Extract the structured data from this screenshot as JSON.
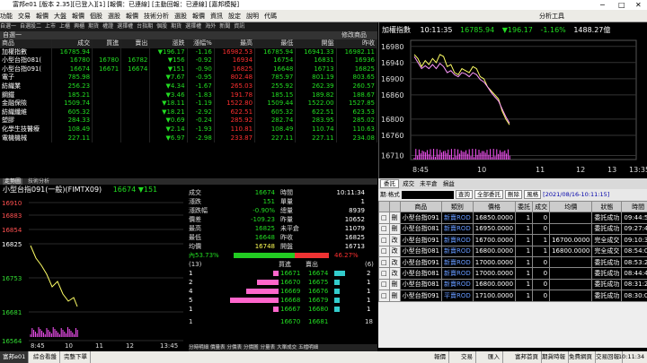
{
  "titlebar": {
    "text": "富邦e01 [版本 2.35][已登入][1] [報價：已連線] [主動回報：已連線] [嘉邦模擬]"
  },
  "menu": [
    "功能",
    "交易",
    "報價",
    "大盤",
    "報價",
    "個股",
    "選股",
    "報價",
    "技術分析",
    "選股",
    "報價",
    "資訊",
    "設定",
    "說明",
    "代碼"
  ],
  "menu_right": "分析工具",
  "tabs_top": [
    "自選一",
    "自選股二",
    "上市",
    "上櫃",
    "興櫃",
    "期貨",
    "權證",
    "選擇權",
    "台指期",
    "個股",
    "期貨",
    "選擇權",
    "海外",
    "新聞",
    "資訊"
  ],
  "watch_header": {
    "title": "自選一",
    "right": "修改商品",
    "columns": [
      "商品",
      "成交",
      "買進",
      "賣出",
      "漲跌",
      "漲幅%",
      "最高",
      "最低",
      "開盤",
      "昨收"
    ]
  },
  "watch_rows": [
    {
      "name": "加權指數",
      "last": "16785.94",
      "bid": "",
      "ask": "",
      "chg": "196.17",
      "pct": "-1.16",
      "high": "16982.53",
      "low": "16785.94",
      "open": "16941.33",
      "prev": "16982.11",
      "c": "dn"
    },
    {
      "name": "小型台指081(",
      "last": "16780",
      "bid": "16780",
      "ask": "16782",
      "chg": "156",
      "pct": "-0.92",
      "high": "16934",
      "low": "16754",
      "open": "16831",
      "prev": "16936",
      "c": "dn"
    },
    {
      "name": "小型台指091(",
      "last": "16674",
      "bid": "16671",
      "ask": "16674",
      "chg": "151",
      "pct": "-0.90",
      "high": "16825",
      "low": "16648",
      "open": "16713",
      "prev": "16825",
      "c": "dn"
    },
    {
      "name": "電子",
      "last": "785.98",
      "bid": "",
      "ask": "",
      "chg": "7.67",
      "pct": "-0.95",
      "high": "802.48",
      "low": "785.97",
      "open": "801.19",
      "prev": "803.65",
      "c": "dn"
    },
    {
      "name": "紡織業",
      "last": "256.23",
      "bid": "",
      "ask": "",
      "chg": "4.34",
      "pct": "-1.67",
      "high": "265.03",
      "low": "255.92",
      "open": "262.39",
      "prev": "260.57",
      "c": "dn"
    },
    {
      "name": "鋼鐵",
      "last": "185.21",
      "bid": "",
      "ask": "",
      "chg": "3.46",
      "pct": "-1.83",
      "high": "191.78",
      "low": "185.15",
      "open": "189.82",
      "prev": "188.67",
      "c": "dn"
    },
    {
      "name": "金融保險",
      "last": "1509.74",
      "bid": "",
      "ask": "",
      "chg": "18.11",
      "pct": "-1.19",
      "high": "1522.80",
      "low": "1509.44",
      "open": "1522.00",
      "prev": "1527.85",
      "c": "dn"
    },
    {
      "name": "紡織纖維",
      "last": "605.32",
      "bid": "",
      "ask": "",
      "chg": "18.21",
      "pct": "-2.92",
      "high": "622.51",
      "low": "605.32",
      "open": "622.51",
      "prev": "623.53",
      "c": "dn"
    },
    {
      "name": "塑膠",
      "last": "284.33",
      "bid": "",
      "ask": "",
      "chg": "0.69",
      "pct": "-0.24",
      "high": "285.92",
      "low": "282.74",
      "open": "283.95",
      "prev": "285.02",
      "c": "dn"
    },
    {
      "name": "化學生技醫療",
      "last": "108.49",
      "bid": "",
      "ask": "",
      "chg": "2.14",
      "pct": "-1.93",
      "high": "110.81",
      "low": "108.49",
      "open": "110.74",
      "prev": "110.63",
      "c": "dn"
    },
    {
      "name": "電機機械",
      "last": "227.11",
      "bid": "",
      "ask": "",
      "chg": "6.97",
      "pct": "-2.98",
      "high": "233.87",
      "open": "227.11",
      "low": "227.11",
      "prev": "234.08",
      "c": "dn"
    }
  ],
  "index_chart": {
    "title": "加權指數",
    "time": "10:11:35",
    "last": "16785.94",
    "chg": "196.17",
    "pct": "-1.16%",
    "vol": "1488.27億",
    "chart_data": {
      "type": "line",
      "y_ticks": [
        16980,
        16940,
        16900,
        16860,
        16800,
        16760,
        16710
      ],
      "x_ticks": [
        "8:45",
        "10",
        "11",
        "12",
        "13",
        "13:35"
      ],
      "series": [
        {
          "values": [
            16960,
            16950,
            16930,
            16945,
            16935,
            16950,
            16940,
            16960,
            16955,
            16930,
            16935,
            16915,
            16910,
            16925,
            16920,
            16915,
            16930,
            16925,
            16905,
            16900,
            16880,
            16870,
            16860,
            16850,
            16820,
            16800,
            16786
          ]
        },
        {
          "values": [
            16955,
            16940,
            16925,
            16932,
            16925,
            16935,
            16925,
            16938,
            16930,
            16915,
            16920,
            16910,
            16905,
            16915,
            16912,
            16905,
            16915,
            16910,
            16898,
            16892,
            16880,
            16866,
            16855,
            16845,
            16825,
            16806,
            16790
          ]
        }
      ]
    }
  },
  "quote": {
    "tabs": [
      "走勢圖",
      "技術分析"
    ],
    "name": "小型台指091(一般)(FIMTX09)",
    "last": "16674",
    "chg": "151",
    "fields": [
      {
        "k": "成交",
        "v": "16674",
        "k2": "時間",
        "v2": "10:11:34"
      },
      {
        "k": "漲跌",
        "v": "151",
        "k2": "單量",
        "v2": "1"
      },
      {
        "k": "漲跌幅",
        "v": "-0.90%",
        "k2": "總量",
        "v2": "8939"
      },
      {
        "k": "價差",
        "v": "-109.23",
        "k2": "昨量",
        "v2": "10652"
      },
      {
        "k": "最高",
        "v": "16825",
        "k2": "未平倉",
        "v2": "11079"
      },
      {
        "k": "最低",
        "v": "16648",
        "k2": "昨收",
        "v2": "16825"
      },
      {
        "k": "均價",
        "v": "16748",
        "k2": "開盤",
        "v2": "16713"
      }
    ],
    "ratio_left": "內53.73%",
    "ratio_right": "46.27%",
    "book_head": {
      "left": "(13)",
      "mid1": "買進",
      "mid2": "賣出",
      "right": "(6)"
    },
    "book": [
      {
        "bq": "1",
        "bp": "16671",
        "ap": "16674",
        "aq": "2",
        "bw": 0.1,
        "aw": 0.4
      },
      {
        "bq": "2",
        "bp": "16670",
        "ap": "16675",
        "aq": "1",
        "bw": 0.4,
        "aw": 0.2
      },
      {
        "bq": "4",
        "bp": "16669",
        "ap": "16676",
        "aq": "1",
        "bw": 0.6,
        "aw": 0.2
      },
      {
        "bq": "5",
        "bp": "16668",
        "ap": "16679",
        "aq": "1",
        "bw": 0.9,
        "aw": 0.2
      },
      {
        "bq": "1",
        "bp": "16667",
        "ap": "16680",
        "aq": "1",
        "bw": 0.1,
        "aw": 0.2
      }
    ],
    "book_foot": {
      "left": "1",
      "bid": "16670",
      "ask": "16681",
      "right": "18"
    },
    "tabs_bottom": [
      "分時明細",
      "價量表",
      "分價表",
      "分價圖",
      "分量表",
      "大單成交",
      "五檔明細"
    ]
  },
  "mini_chart": {
    "chart_data": {
      "type": "line",
      "y_ticks": [
        16910,
        16883,
        16854,
        16825,
        16753,
        16681,
        16564
      ],
      "x_ticks": [
        "8:45",
        "10",
        "11",
        "12",
        "13:45"
      ]
    },
    "label": "16825"
  },
  "orders": {
    "account_label": "期:格式",
    "query": "查詢",
    "filter": "全部委託",
    "delete": "刪除",
    "scroll": "風格",
    "date": "[2021/08/16-10:11:15]",
    "columns": [
      "",
      "",
      "商品",
      "類別",
      "價格",
      "委託",
      "成交",
      "均價",
      "狀態",
      "時間"
    ],
    "rows": [
      {
        "x": "刪",
        "product": "小型台指091",
        "type": "新賣ROD",
        "price": "16850.0000",
        "q": "1",
        "f": "0",
        "avg": "",
        "status": "委託成功",
        "time": "09:44:54"
      },
      {
        "x": "刪",
        "product": "小型台指081",
        "type": "新賣ROD",
        "price": "16950.0000",
        "q": "1",
        "f": "0",
        "avg": "",
        "status": "委託成功",
        "time": "09:27:43"
      },
      {
        "x": "改",
        "product": "小型台指091",
        "type": "新賣ROD",
        "price": "16700.0000",
        "q": "1",
        "f": "1",
        "avg": "16700.0000",
        "status": "完全成交",
        "time": "09:10:39"
      },
      {
        "x": "改",
        "product": "小型台指081",
        "type": "新賣ROD",
        "price": "16800.0000",
        "q": "1",
        "f": "1",
        "avg": "16800.0000",
        "status": "完全成交",
        "time": "08:54:03"
      },
      {
        "x": "改",
        "product": "小型台指091",
        "type": "新賣ROD",
        "price": "17000.0000",
        "q": "1",
        "f": "0",
        "avg": "",
        "status": "委託成功",
        "time": "08:53:22"
      },
      {
        "x": "改",
        "product": "小型台指081",
        "type": "新賣ROD",
        "price": "17000.0000",
        "q": "1",
        "f": "0",
        "avg": "",
        "status": "委託成功",
        "time": "08:44:44"
      },
      {
        "x": "刪",
        "product": "小型台指081",
        "type": "新賣ROD",
        "price": "16800.0000",
        "q": "1",
        "f": "0",
        "avg": "",
        "status": "委託成功",
        "time": "08:31:23"
      },
      {
        "x": "刪",
        "product": "小型台指091",
        "type": "平賣ROD",
        "price": "17100.0000",
        "q": "1",
        "f": "0",
        "avg": "",
        "status": "委託成功",
        "time": "08:30:03"
      }
    ]
  },
  "statusbar": {
    "left_tabs": [
      "富邦e01",
      "綜合看盤",
      "完整下單"
    ],
    "right_items": [
      "報價",
      "交易",
      "匯入",
      "富邦首頁",
      "期貨時報",
      "免費網頁",
      "交易回報"
    ],
    "clock": "10:11:34"
  }
}
